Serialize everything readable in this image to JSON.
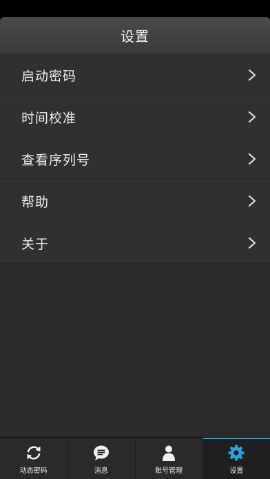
{
  "header": {
    "title": "设置"
  },
  "menu": {
    "items": [
      {
        "label": "启动密码"
      },
      {
        "label": "时间校准"
      },
      {
        "label": "查看序列号"
      },
      {
        "label": "帮助"
      },
      {
        "label": "关于"
      }
    ]
  },
  "tabbar": {
    "active_index": 3,
    "active_color": "#2ea0dc",
    "tabs": [
      {
        "label": "动态密码",
        "icon": "refresh-icon"
      },
      {
        "label": "消息",
        "icon": "message-icon"
      },
      {
        "label": "账号管理",
        "icon": "person-icon"
      },
      {
        "label": "设置",
        "icon": "gear-icon"
      }
    ]
  }
}
